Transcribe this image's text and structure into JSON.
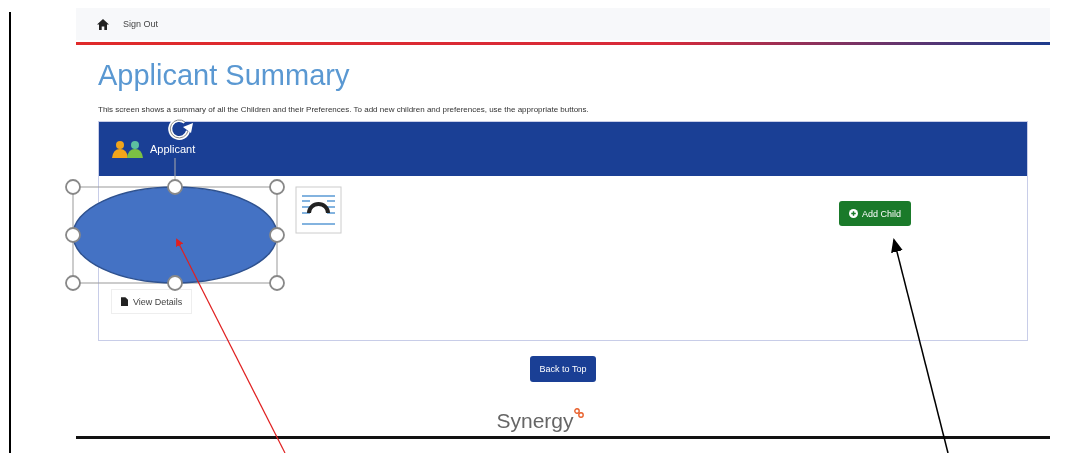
{
  "nav": {
    "sign_out": "Sign Out"
  },
  "title": "Applicant Summary",
  "description": "This screen shows a summary of all the Children and their Preferences. To add new children and preferences, use the appropriate buttons.",
  "panel": {
    "heading": "Applicant",
    "view_details": "View Details",
    "add_child": "Add Child"
  },
  "back_to_top": "Back to Top",
  "footer": {
    "logo": "Synergy"
  }
}
